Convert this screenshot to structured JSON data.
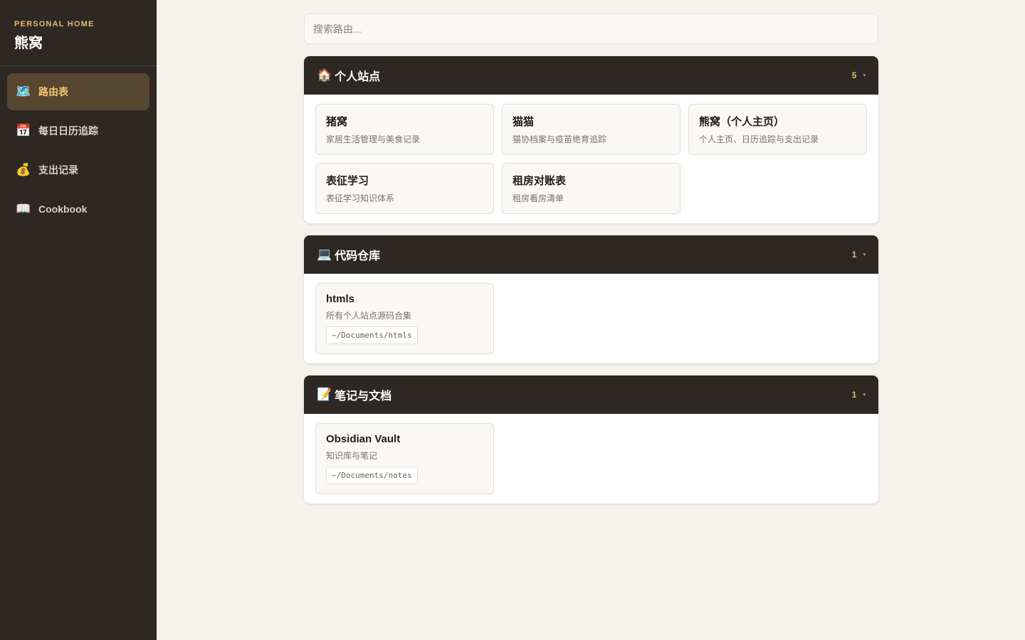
{
  "sidebar": {
    "kicker": "PERSONAL HOME",
    "title": "熊窝",
    "items": [
      {
        "icon": "🗺️",
        "label": "路由表",
        "active": true
      },
      {
        "icon": "📅",
        "label": "每日日历追踪",
        "active": false
      },
      {
        "icon": "💰",
        "label": "支出记录",
        "active": false
      },
      {
        "icon": "📖",
        "label": "Cookbook",
        "active": false
      }
    ]
  },
  "search": {
    "placeholder": "搜索路由..."
  },
  "groups": [
    {
      "icon": "🏠",
      "title": "个人站点",
      "count": "5",
      "caret": "▾",
      "cards": [
        {
          "title": "猪窝",
          "desc": "家居生活管理与美食记录"
        },
        {
          "title": "猫猫",
          "desc": "猫协档案与疫苗绝育追踪"
        },
        {
          "title": "熊窝（个人主页）",
          "desc": "个人主页、日历追踪与支出记录"
        },
        {
          "title": "表征学习",
          "desc": "表征学习知识体系"
        },
        {
          "title": "租房对账表",
          "desc": "租房看房清单"
        }
      ]
    },
    {
      "icon": "💻",
      "title": "代码仓库",
      "count": "1",
      "caret": "▾",
      "cards": [
        {
          "title": "htmls",
          "desc": "所有个人站点源码合集",
          "path": "~/Documents/htmls"
        }
      ]
    },
    {
      "icon": "📝",
      "title": "笔记与文档",
      "count": "1",
      "caret": "▾",
      "cards": [
        {
          "title": "Obsidian Vault",
          "desc": "知识库与笔记",
          "path": "~/Documents/notes"
        }
      ]
    }
  ],
  "colors": {
    "sidebar_bg": "#2d2824",
    "accent": "#e6b96a",
    "active_bg": "#574630",
    "page_bg": "#f5f2ed"
  }
}
